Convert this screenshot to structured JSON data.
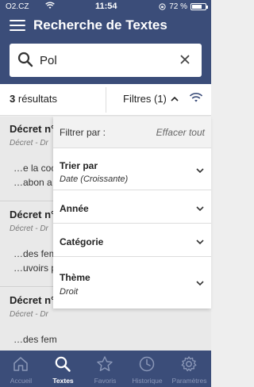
{
  "status": {
    "carrier": "O2.CZ",
    "time": "11:54",
    "battery": "72 %",
    "battery_level": 0.72
  },
  "header": {
    "title": "Recherche de Textes"
  },
  "search": {
    "value": "Pol"
  },
  "results": {
    "count": "3",
    "label": "résultats",
    "filters_label": "Filtres (1)"
  },
  "list": {
    "items": [
      {
        "title": "Décret n°",
        "subtitle": "Décret - Dr",
        "line1": "…e la coc",
        "line2": "…abon a"
      },
      {
        "title": "Décret n°",
        "subtitle": "Décret - Dr",
        "line1": "…des fem",
        "line2": "…uvoirs p"
      },
      {
        "title": "Décret n°",
        "subtitle": "Décret - Dr",
        "line1": "…des fem",
        "line2": "…"
      }
    ]
  },
  "filter_panel": {
    "header_label": "Filtrer par :",
    "reset_label": "Effacer tout",
    "rows": [
      {
        "label": "Trier par",
        "value": "Date (Croissante)"
      },
      {
        "label": "Année",
        "value": ""
      },
      {
        "label": "Catégorie",
        "value": ""
      },
      {
        "label": "Thème",
        "value": "Droit"
      }
    ]
  },
  "tabbar": {
    "tabs": [
      {
        "label": "Accueil",
        "icon": "home-icon"
      },
      {
        "label": "Textes",
        "icon": "search-icon"
      },
      {
        "label": "Favoris",
        "icon": "star-icon"
      },
      {
        "label": "Historique",
        "icon": "history-icon"
      },
      {
        "label": "Paramètres",
        "icon": "gear-icon"
      }
    ],
    "active_index": 1
  },
  "colors": {
    "brand": "#3b4d79",
    "tab_inactive": "#8b98b8",
    "tab_active": "#ffffff"
  }
}
